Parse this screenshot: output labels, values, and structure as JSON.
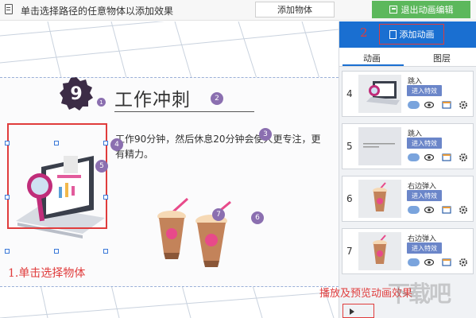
{
  "toolbar": {
    "hint": "单击选择路径的任意物体以添加效果",
    "add_object_label": "添加物体",
    "exit_label": "退出动画编辑"
  },
  "slide": {
    "badge_number": "9",
    "title": "工作冲刺",
    "body": "工作90分钟，然后休息20分钟会使人更专注，更有精力。",
    "sequence_markers": [
      "1",
      "2",
      "3",
      "4",
      "5",
      "6",
      "7"
    ],
    "step1_label": "1.单击选择物体"
  },
  "panel": {
    "step2_label": "2",
    "add_animation_label": "添加动画",
    "tabs": [
      {
        "label": "动画",
        "active": true
      },
      {
        "label": "图层",
        "active": false
      }
    ],
    "items": [
      {
        "index": "4",
        "effect": "跳入",
        "fx_label": "进入特效"
      },
      {
        "index": "5",
        "effect": "跳入",
        "fx_label": "进入特效"
      },
      {
        "index": "6",
        "effect": "右边弹入",
        "fx_label": "进入特效"
      },
      {
        "index": "7",
        "effect": "右边弹入",
        "fx_label": "进入特效"
      }
    ],
    "preview_label": "播放及预览动画效果"
  },
  "colors": {
    "accent_blue": "#1a6fd1",
    "exit_green": "#5cb85c",
    "annotation_red": "#e03c3c",
    "marker_purple": "#8b6fb0",
    "fx_button": "#6b86c9"
  }
}
